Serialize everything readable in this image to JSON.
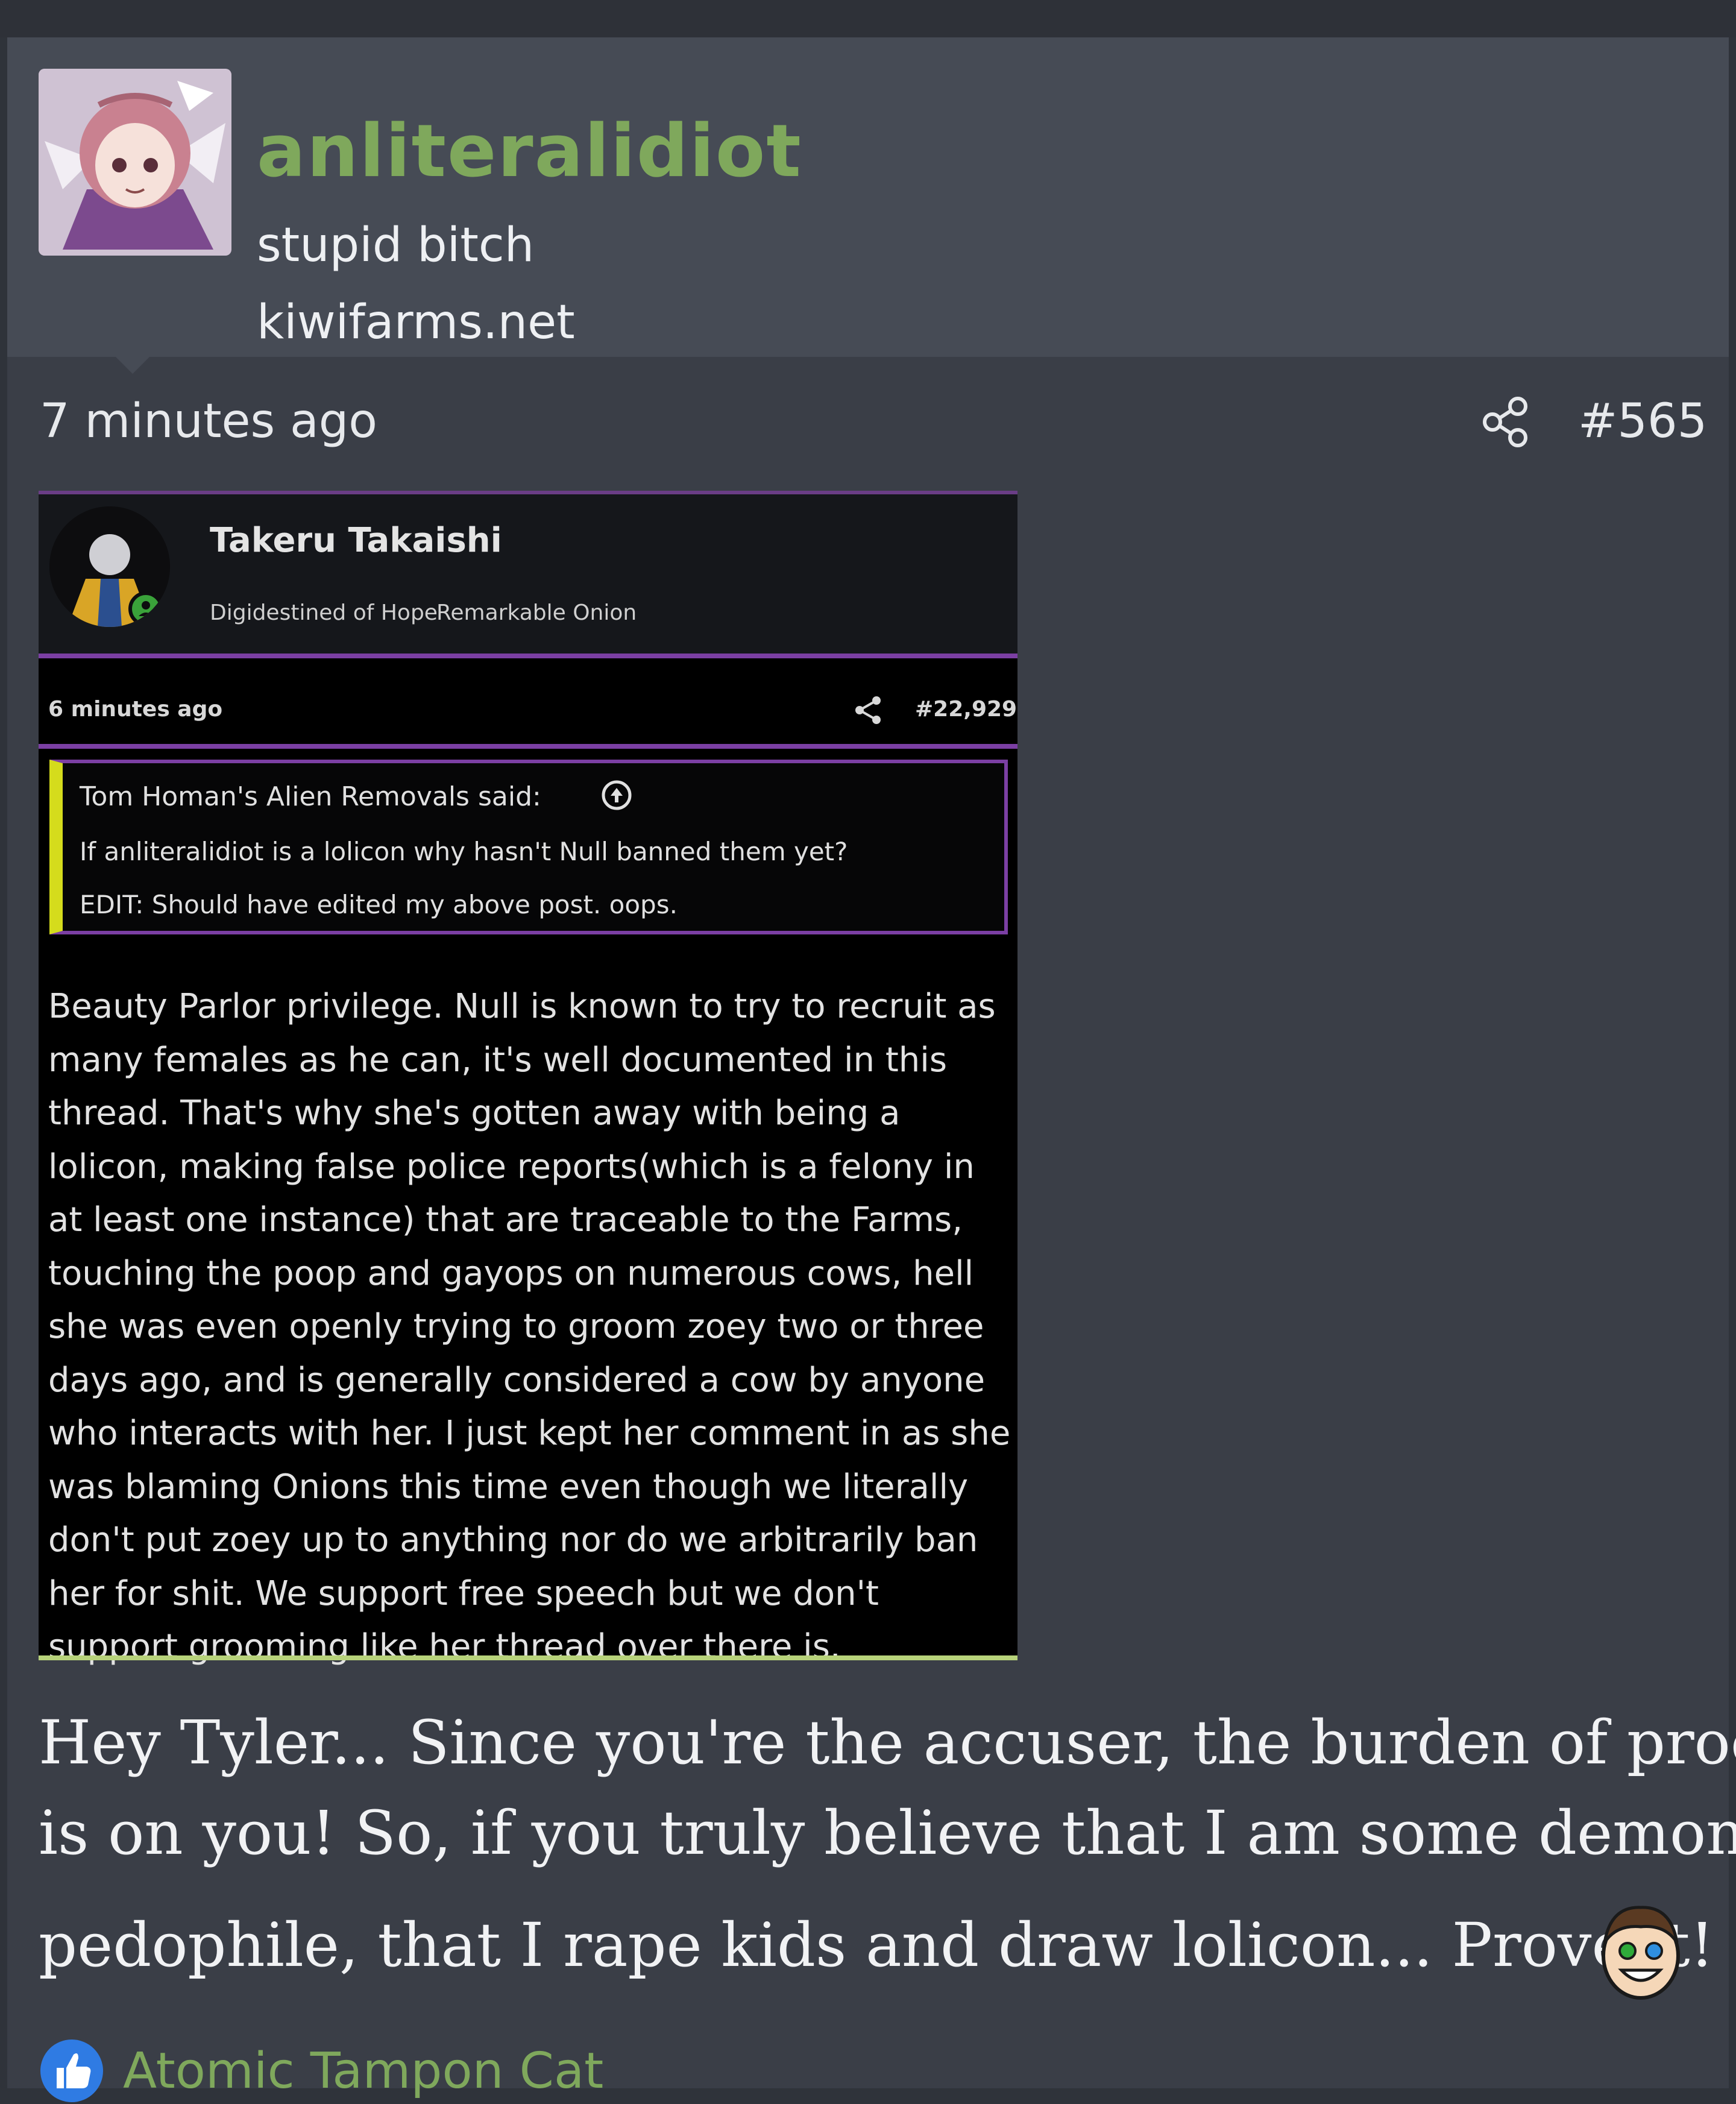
{
  "user": {
    "name": "anliteralidiot",
    "title": "stupid bitch",
    "site": "kiwifarms.net"
  },
  "post": {
    "time": "7 minutes ago",
    "number": "#565",
    "icons": {
      "share": "share-icon"
    }
  },
  "embedded_screenshot": {
    "author": "Takeru Takaishi",
    "badges": [
      "Digidestined of Hope",
      "Remarkable Onion"
    ],
    "time": "6 minutes ago",
    "number": "#22,929",
    "quote": {
      "author": "Tom Homan's Alien Removals said:",
      "lines": [
        "If anliteralidiot is a lolicon why hasn't Null banned them yet?",
        "EDIT: Should have edited my above post. oops."
      ]
    },
    "body_lines": [
      "Beauty Parlor privilege. Null is known to try to recruit as",
      "many females as he can, it's well documented in this",
      "thread. That's why she's gotten away with being a",
      "lolicon, making false police reports(which is a felony in",
      "at least one instance) that are traceable to the Farms,",
      "touching the poop and gayops on numerous cows, hell",
      "she was even openly trying to groom zoey two or three",
      "days ago, and is generally considered a cow by anyone",
      "who interacts with her. I just kept her comment in as she",
      "was blaming Onions this time even though we literally",
      "don't put zoey up to anything nor do we arbitrarily ban",
      "her for shit. We support free speech but we don't",
      "support grooming like her thread over there is."
    ]
  },
  "message_lines": [
    "Hey Tyler... Since you're the accuser, the burden of proof",
    "is on you! So, if you truly believe that I am some demonic",
    "pedophile, that I rape kids and draw lolicon... Prove it!"
  ],
  "reactions": {
    "icon": "like-icon",
    "users": "Atomic Tampon Cat"
  },
  "colors": {
    "username": "#7fa85c",
    "background": "#3a3e47",
    "header": "#464b55",
    "embed_accent": "#7b3fa3",
    "quote_bar": "#d5dc1c"
  }
}
